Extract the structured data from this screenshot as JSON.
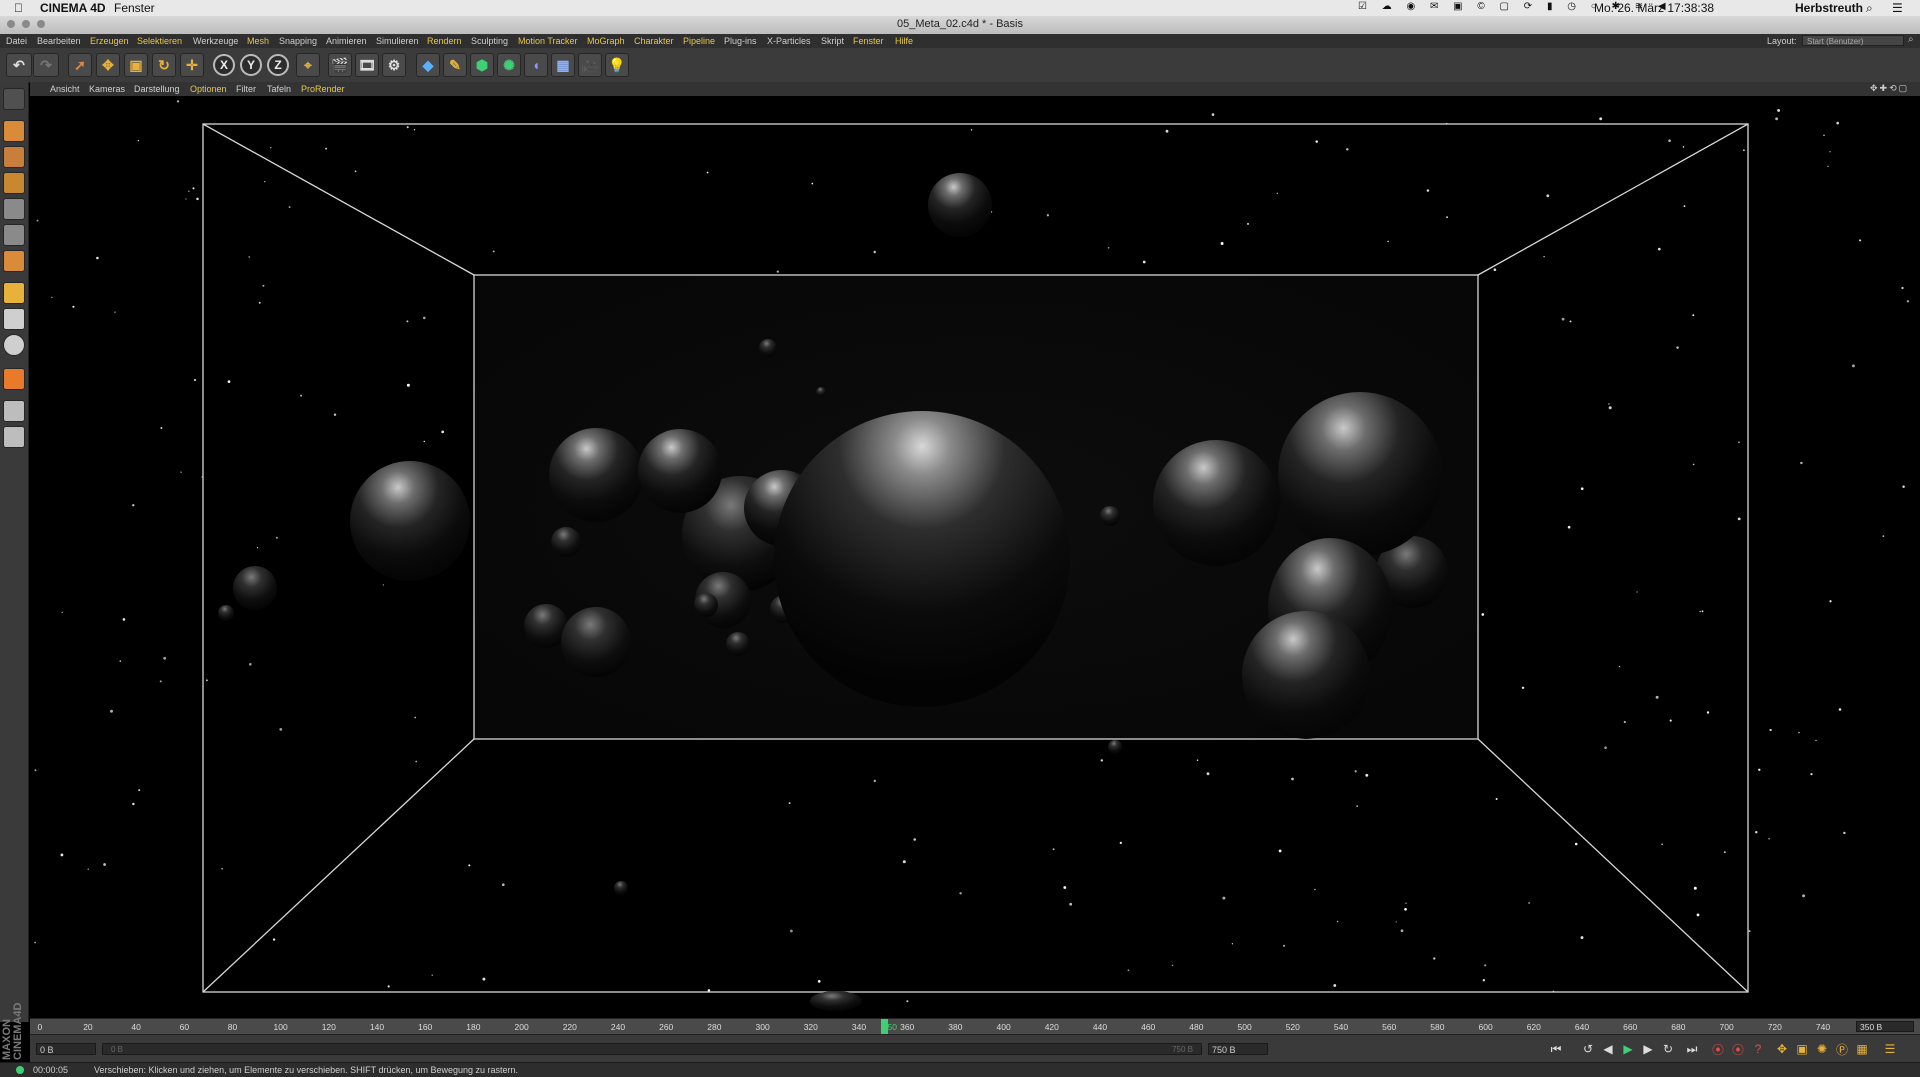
{
  "mac_menubar": {
    "app_name": "CINEMA 4D",
    "menu_item": "Fenster",
    "datetime": "Mo. 26. März  17:38:38",
    "user": "Herbstreuth"
  },
  "window": {
    "title": "05_Meta_02.c4d * - Basis"
  },
  "main_menu": {
    "items": [
      {
        "label": "Datei",
        "highlight": false
      },
      {
        "label": "Bearbeiten",
        "highlight": false
      },
      {
        "label": "Erzeugen",
        "highlight": true
      },
      {
        "label": "Selektieren",
        "highlight": true
      },
      {
        "label": "Werkzeuge",
        "highlight": false
      },
      {
        "label": "Mesh",
        "highlight": true
      },
      {
        "label": "Snapping",
        "highlight": false
      },
      {
        "label": "Animieren",
        "highlight": false
      },
      {
        "label": "Simulieren",
        "highlight": false
      },
      {
        "label": "Rendern",
        "highlight": true
      },
      {
        "label": "Sculpting",
        "highlight": false
      },
      {
        "label": "Motion Tracker",
        "highlight": true
      },
      {
        "label": "MoGraph",
        "highlight": true
      },
      {
        "label": "Charakter",
        "highlight": true
      },
      {
        "label": "Pipeline",
        "highlight": true
      },
      {
        "label": "Plug-ins",
        "highlight": false
      },
      {
        "label": "X-Particles",
        "highlight": false
      },
      {
        "label": "Skript",
        "highlight": false
      },
      {
        "label": "Fenster",
        "highlight": true
      },
      {
        "label": "Hilfe",
        "highlight": true
      }
    ],
    "layout_label": "Layout:",
    "layout_value": "Start (Benutzer)"
  },
  "viewport_menu": {
    "items": [
      {
        "label": "Ansicht",
        "highlight": false
      },
      {
        "label": "Kameras",
        "highlight": false
      },
      {
        "label": "Darstellung",
        "highlight": false
      },
      {
        "label": "Optionen",
        "highlight": true
      },
      {
        "label": "Filter",
        "highlight": false
      },
      {
        "label": "Tafeln",
        "highlight": false
      },
      {
        "label": "ProRender",
        "highlight": true
      }
    ]
  },
  "toolbar": {
    "axis_x": "X",
    "axis_y": "Y",
    "axis_z": "Z"
  },
  "timeline": {
    "ticks": [
      "0",
      "20",
      "40",
      "60",
      "80",
      "100",
      "120",
      "140",
      "160",
      "180",
      "200",
      "220",
      "240",
      "260",
      "280",
      "300",
      "320",
      "340",
      "360",
      "380",
      "400",
      "420",
      "440",
      "460",
      "480",
      "500",
      "520",
      "540",
      "560",
      "580",
      "600",
      "620",
      "640",
      "660",
      "680",
      "700",
      "720",
      "740"
    ],
    "current_frame": "350",
    "current_frame_fraction": 0.4667,
    "end_label": "350 B"
  },
  "transport": {
    "start_field": "0 B",
    "range_start": "0 B",
    "range_end": "750 B",
    "end_field": "750 B"
  },
  "status": {
    "time": "00:00:05",
    "message": "Verschieben: Klicken und ziehen, um Elemente zu verschieben. SHIFT drücken, um Bewegung zu rastern."
  },
  "colors": {
    "menu_highlight": "#e8c64a",
    "playhead": "#3fcf75",
    "background": "#000000"
  }
}
